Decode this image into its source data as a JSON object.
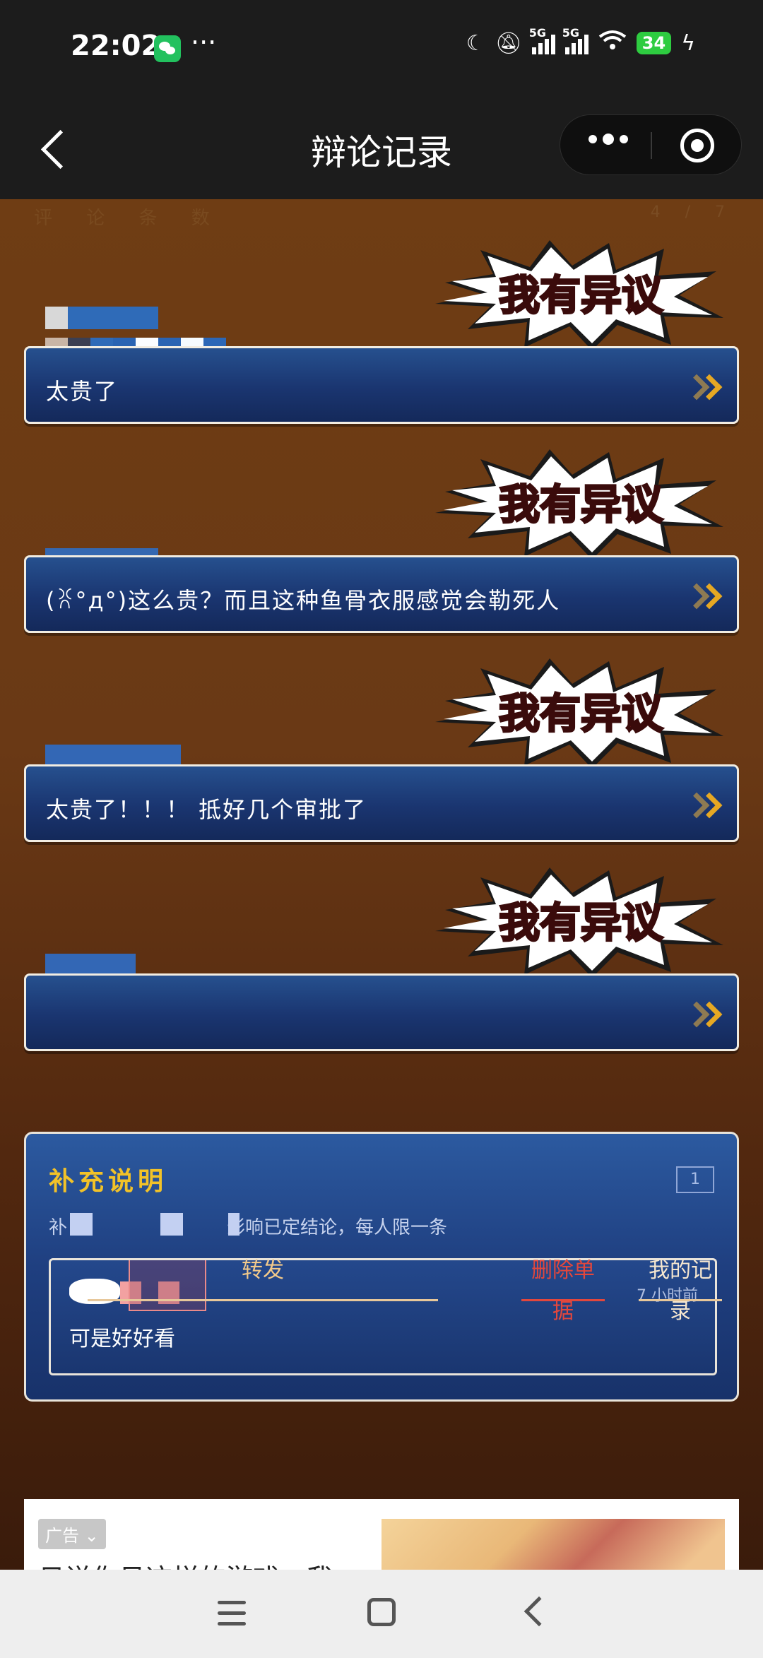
{
  "status_bar": {
    "time": "22:02",
    "more": "···",
    "network_1": "5G",
    "network_2": "5G",
    "battery": "34",
    "icons": [
      "wechat-icon",
      "moon-icon",
      "mute-bell-icon",
      "signal-icon",
      "wifi-icon",
      "battery-icon",
      "charging-icon"
    ]
  },
  "nav": {
    "title": "辩论记录",
    "more_icon": "more-dots-icon",
    "close_icon": "target-close-icon"
  },
  "content": {
    "faint_header": "评 论 条 数",
    "faint_page": "4 / 7"
  },
  "objection_badge": "我有异议",
  "entries": [
    {
      "text": "太贵了"
    },
    {
      "text": "(ꐦ°д°)这么贵？而且这种鱼骨衣服感觉会勒死人"
    },
    {
      "text": "太贵了！！！ 抵好几个审批了"
    },
    {
      "text": ""
    }
  ],
  "supplement": {
    "title": "补充说明",
    "count": "1",
    "desc_prefix": "补",
    "desc_suffix": "影响已定结论，每人限一条",
    "comment": {
      "time": "7 小时前",
      "message": "可是好好看"
    }
  },
  "actions": {
    "forward": "转发",
    "delete": "删除单据",
    "my_records": "我的记录"
  },
  "ad": {
    "tag": "广告",
    "text": "日说你见这样的游戏，我"
  },
  "colors": {
    "accent_gold": "#f2c228",
    "danger_red": "#e2473d",
    "bar_blue": "#1a3570",
    "bg_brown": "#6f3d14"
  }
}
